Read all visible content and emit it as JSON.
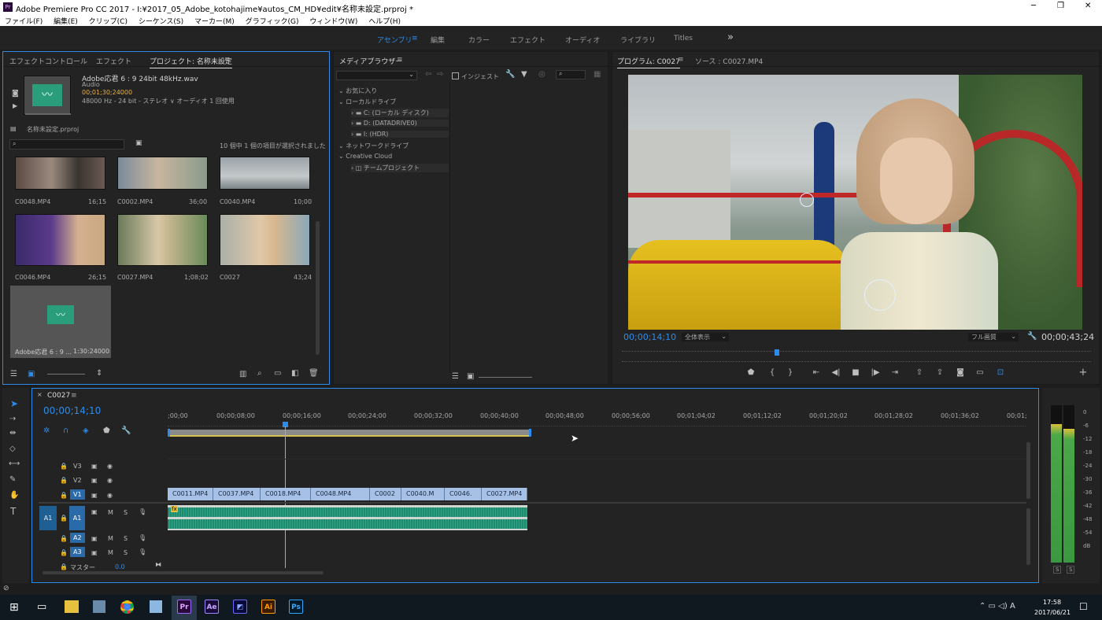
{
  "window": {
    "title": "Adobe Premiere Pro CC 2017 - I:¥2017_05_Adobe_kotohajime¥autos_CM_HD¥edit¥名称未設定.prproj *",
    "controls": [
      "─",
      "❐",
      "✕"
    ]
  },
  "menu": [
    "ファイル(F)",
    "編集(E)",
    "クリップ(C)",
    "シーケンス(S)",
    "マーカー(M)",
    "グラフィック(G)",
    "ウィンドウ(W)",
    "ヘルプ(H)"
  ],
  "workspaces": {
    "items": [
      "アセンブリ",
      "編集",
      "カラー",
      "エフェクト",
      "オーディオ",
      "ライブラリ",
      "Titles"
    ],
    "active": "アセンブリ",
    "more": "»"
  },
  "project_panel": {
    "tabs": [
      "エフェクトコントロール",
      "エフェクト",
      "プロジェクト: 名称未設定"
    ],
    "preview": {
      "name": "Adobe応君 6 : 9 24bit 48kHz.wav",
      "type": "Audio",
      "duration": "00;01;30;24000",
      "info": "48000 Hz - 24 bit - ステレオ ∨ オーディオ 1 回使用"
    },
    "project_file": "名称未設定.prproj",
    "search_placeholder": "",
    "selection_info": "10 個中 1 個の項目が選択されました",
    "items": [
      {
        "name": "C0048.MP4",
        "dur": "16;15"
      },
      {
        "name": "C0002.MP4",
        "dur": "36;00"
      },
      {
        "name": "C0040.MP4",
        "dur": "10;00"
      },
      {
        "name": "C0046.MP4",
        "dur": "26;15"
      },
      {
        "name": "C0027.MP4",
        "dur": "1;08;02"
      },
      {
        "name": "C0027",
        "dur": "43;24"
      },
      {
        "name": "Adobe応君 6 : 9 ...",
        "dur": "1:30:24000"
      }
    ]
  },
  "media_browser": {
    "title": "メディアブラウザー",
    "ingest": "インジェスト",
    "tree": [
      {
        "label": "お気に入り",
        "level": 0
      },
      {
        "label": "ローカルドライブ",
        "level": 0
      },
      {
        "label": "C: (ローカル ディスク)",
        "level": 1
      },
      {
        "label": "D: (DATADRIVE0)",
        "level": 1
      },
      {
        "label": "I: (HDR)",
        "level": 1
      },
      {
        "label": "ネットワークドライブ",
        "level": 0
      },
      {
        "label": "Creative Cloud",
        "level": 0
      },
      {
        "label": "チームプロジェクト",
        "level": 1
      }
    ]
  },
  "program_monitor": {
    "tabs": [
      "プログラム: C0027",
      "ソース : C0027.MP4"
    ],
    "timecode": "00;00;14;10",
    "zoom": "全体表示",
    "quality": "フル画質",
    "duration": "00;00;43;24",
    "playhead_fraction": 0.33
  },
  "timeline": {
    "sequence": "C0027",
    "timecode": "00;00;14;10",
    "ruler": [
      ";00;00",
      "00;00;08;00",
      "00;00;16;00",
      "00;00;24;00",
      "00;00;32;00",
      "00;00;40;00",
      "00;00;48;00",
      "00;00;56;00",
      "00;01;04;02",
      "00;01;12;02",
      "00;01;20;02",
      "00;01;28;02",
      "00;01;36;02",
      "00;01;"
    ],
    "tracks": [
      "V3",
      "V2",
      "V1",
      "A1",
      "A2",
      "A3"
    ],
    "master": "マスター",
    "master_val": "0.0",
    "clips": [
      {
        "name": "C0011.MP4"
      },
      {
        "name": "C0037.MP4"
      },
      {
        "name": "C0018.MP4"
      },
      {
        "name": "C0048.MP4"
      },
      {
        "name": "C0002"
      },
      {
        "name": "C0040.M"
      },
      {
        "name": "C0046."
      },
      {
        "name": "C0027.MP4"
      }
    ],
    "track_btns": {
      "m": "M",
      "s": "S",
      "a1src": "A1"
    }
  },
  "meter": {
    "scale": [
      "0",
      "-6",
      "-12",
      "-18",
      "-24",
      "-30",
      "-36",
      "-42",
      "-48",
      "-54",
      "dB"
    ],
    "solo": [
      "S",
      "S"
    ]
  },
  "taskbar": {
    "time": "17:58",
    "date": "2017/06/21",
    "apps": [
      "Pr",
      "Ae",
      "Ai",
      "Ps"
    ]
  },
  "colors": {
    "accent": "#2d8ceb",
    "clip": "#a6c0e6",
    "audio": "#1f8a6e",
    "work": "#d6c050"
  }
}
